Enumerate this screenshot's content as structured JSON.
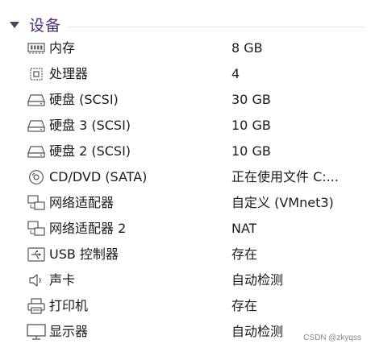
{
  "section": {
    "title": "设备"
  },
  "devices": [
    {
      "name": "内存",
      "value": "8 GB",
      "icon": "memory-icon"
    },
    {
      "name": "处理器",
      "value": "4",
      "icon": "processor-icon"
    },
    {
      "name": "硬盘 (SCSI)",
      "value": "30 GB",
      "icon": "hard-disk-icon"
    },
    {
      "name": "硬盘 3 (SCSI)",
      "value": "10 GB",
      "icon": "hard-disk-icon"
    },
    {
      "name": "硬盘 2 (SCSI)",
      "value": "10 GB",
      "icon": "hard-disk-icon"
    },
    {
      "name": "CD/DVD (SATA)",
      "value": "正在使用文件 C:...",
      "icon": "cd-dvd-icon"
    },
    {
      "name": "网络适配器",
      "value": "自定义 (VMnet3)",
      "icon": "network-adapter-icon"
    },
    {
      "name": "网络适配器 2",
      "value": "NAT",
      "icon": "network-adapter-icon"
    },
    {
      "name": "USB 控制器",
      "value": "存在",
      "icon": "usb-icon"
    },
    {
      "name": "声卡",
      "value": "自动检测",
      "icon": "speaker-icon"
    },
    {
      "name": "打印机",
      "value": "存在",
      "icon": "printer-icon"
    },
    {
      "name": "显示器",
      "value": "自动检测",
      "icon": "monitor-icon"
    }
  ],
  "watermark": "CSDN @zkyqss"
}
